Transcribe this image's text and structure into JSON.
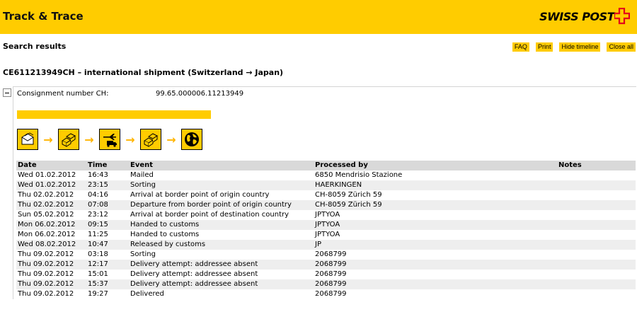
{
  "header": {
    "title": "Track & Trace",
    "logo_text": "SWISS POST"
  },
  "search_results_label": "Search results",
  "toolbar": {
    "faq": "FAQ",
    "print": "Print",
    "hide_timeline": "Hide timeline",
    "close_all": "Close all"
  },
  "shipment": {
    "title": "CE611213949CH – international shipment (Switzerland → Japan)",
    "consignment_label": "Consignment number CH:",
    "consignment_value": "99.65.000006.11213949",
    "progress_fraction": 1.0
  },
  "timeline_icons": [
    "envelope-parcel-icon",
    "parcels-icon",
    "plane-truck-icon",
    "parcels-icon",
    "globe-icon"
  ],
  "colors": {
    "brand_yellow": "#ffcc00",
    "header_row": "#d9d9d9",
    "alt_row": "#eeeeee",
    "logo_red": "#e2001a"
  },
  "table": {
    "headers": {
      "date": "Date",
      "time": "Time",
      "event": "Event",
      "processed_by": "Processed by",
      "notes": "Notes"
    },
    "rows": [
      {
        "date": "Wed 01.02.2012",
        "time": "16:43",
        "event": "Mailed",
        "processed_by": "6850 Mendrisio Stazione",
        "notes": ""
      },
      {
        "date": "Wed 01.02.2012",
        "time": "23:15",
        "event": "Sorting",
        "processed_by": "HAERKINGEN",
        "notes": ""
      },
      {
        "date": "Thu  02.02.2012",
        "time": "04:16",
        "event": "Arrival at border point of origin country",
        "processed_by": "CH-8059 Zürich 59",
        "notes": ""
      },
      {
        "date": "Thu  02.02.2012",
        "time": "07:08",
        "event": "Departure from border point of origin country",
        "processed_by": "CH-8059 Zürich 59",
        "notes": ""
      },
      {
        "date": "Sun  05.02.2012",
        "time": "23:12",
        "event": "Arrival at border point of destination country",
        "processed_by": "JPTYOA",
        "notes": ""
      },
      {
        "date": "Mon  06.02.2012",
        "time": "09:15",
        "event": "Handed to customs",
        "processed_by": "JPTYOA",
        "notes": ""
      },
      {
        "date": "Mon  06.02.2012",
        "time": "11:25",
        "event": "Handed to customs",
        "processed_by": "JPTYOA",
        "notes": ""
      },
      {
        "date": "Wed 08.02.2012",
        "time": "10:47",
        "event": "Released by customs",
        "processed_by": "JP",
        "notes": ""
      },
      {
        "date": "Thu  09.02.2012",
        "time": "03:18",
        "event": "Sorting",
        "processed_by": "2068799",
        "notes": ""
      },
      {
        "date": "Thu  09.02.2012",
        "time": "12:17",
        "event": "Delivery attempt: addressee absent",
        "processed_by": "2068799",
        "notes": ""
      },
      {
        "date": "Thu  09.02.2012",
        "time": "15:01",
        "event": "Delivery attempt: addressee absent",
        "processed_by": "2068799",
        "notes": ""
      },
      {
        "date": "Thu  09.02.2012",
        "time": "15:37",
        "event": "Delivery attempt: addressee absent",
        "processed_by": "2068799",
        "notes": ""
      },
      {
        "date": "Thu  09.02.2012",
        "time": "19:27",
        "event": "Delivered",
        "processed_by": "2068799",
        "notes": ""
      }
    ]
  }
}
